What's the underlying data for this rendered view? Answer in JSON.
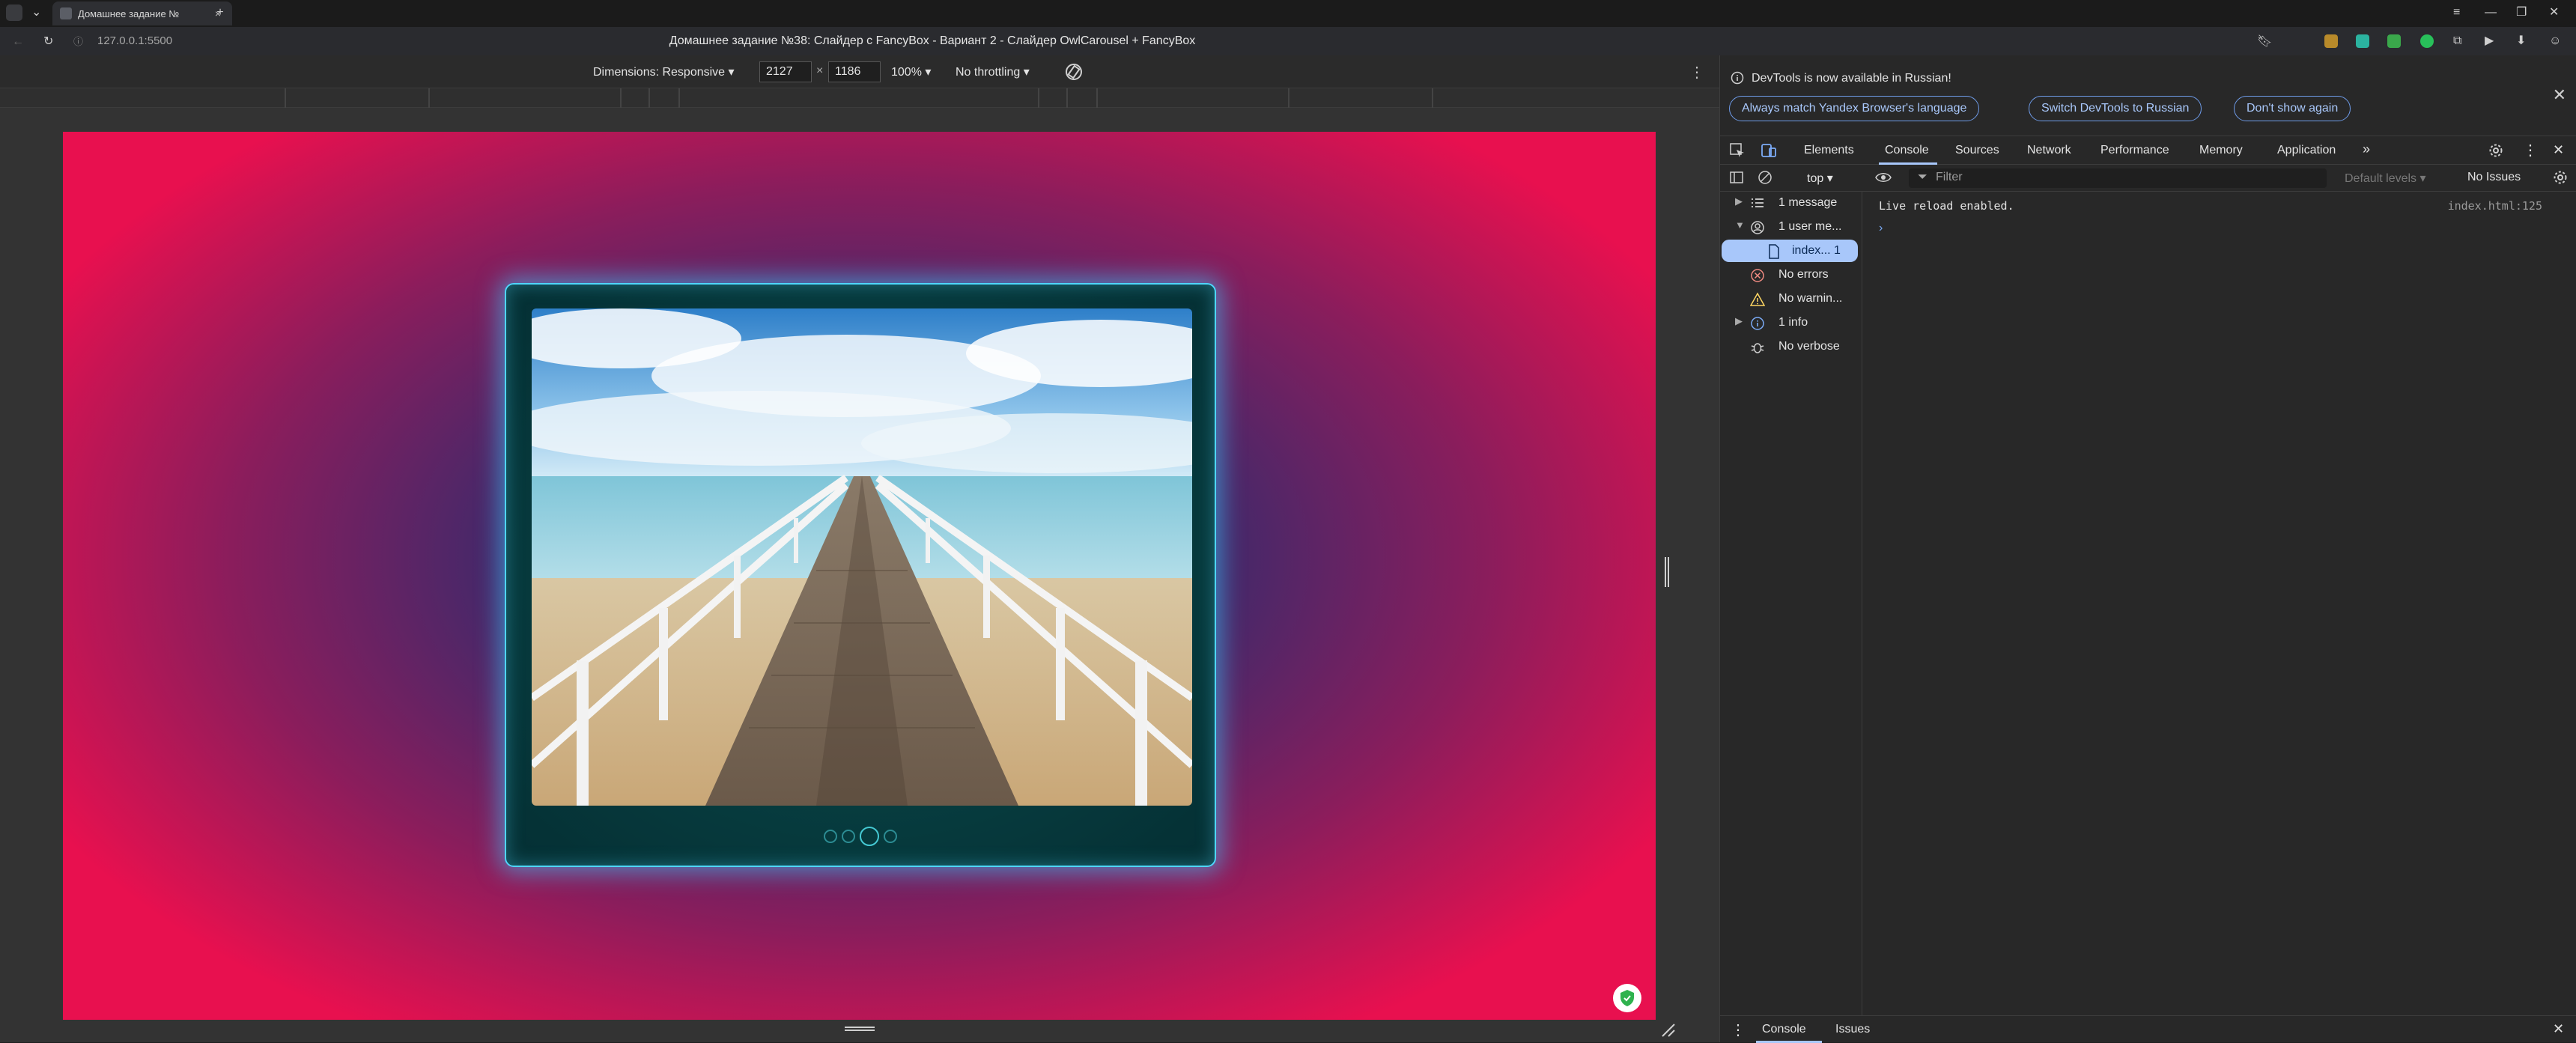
{
  "browser": {
    "tab_title": "Домашнее задание №",
    "tab_close": "×",
    "new_tab": "+",
    "url": "127.0.0.1:5500",
    "page_title": "Домашнее задание №38: Слайдер с FancyBox - Вариант 2 - Слайдер OwlCarousel + FancyBox",
    "window_controls": [
      "≡",
      "—",
      "❐",
      "✕"
    ]
  },
  "device_toolbar": {
    "dimensions_label": "Dimensions: Responsive",
    "width_value": "2127",
    "height_value": "1186",
    "times": "×",
    "zoom": "100%",
    "throttling": "No throttling"
  },
  "slider": {
    "dots_count": 4,
    "active_dot_index": 2,
    "accent_color": "#4fd6ff"
  },
  "devtools": {
    "info_message": "DevTools is now available in Russian!",
    "info_buttons": [
      "Always match Yandex Browser's language",
      "Switch DevTools to Russian",
      "Don't show again"
    ],
    "tabs": [
      "Elements",
      "Console",
      "Sources",
      "Network",
      "Performance",
      "Memory",
      "Application"
    ],
    "active_tab": "Console",
    "context": "top",
    "filter_placeholder": "Filter",
    "levels": "Default levels",
    "issues": "No Issues",
    "sidebar": [
      {
        "label": "1 message",
        "icon": "list-icon",
        "expandable": true
      },
      {
        "label": "1 user me...",
        "icon": "user-icon",
        "expanded": true
      },
      {
        "label": "index... 1",
        "icon": "file-icon",
        "selected": true
      },
      {
        "label": "No errors",
        "icon": "error-icon"
      },
      {
        "label": "No warnin...",
        "icon": "warning-icon"
      },
      {
        "label": "1 info",
        "icon": "info-icon",
        "expandable": true
      },
      {
        "label": "No verbose",
        "icon": "bug-icon"
      }
    ],
    "log": {
      "message": "Live reload enabled.",
      "source": "index.html:125"
    },
    "drawer_tabs": [
      "Console",
      "Issues"
    ]
  }
}
